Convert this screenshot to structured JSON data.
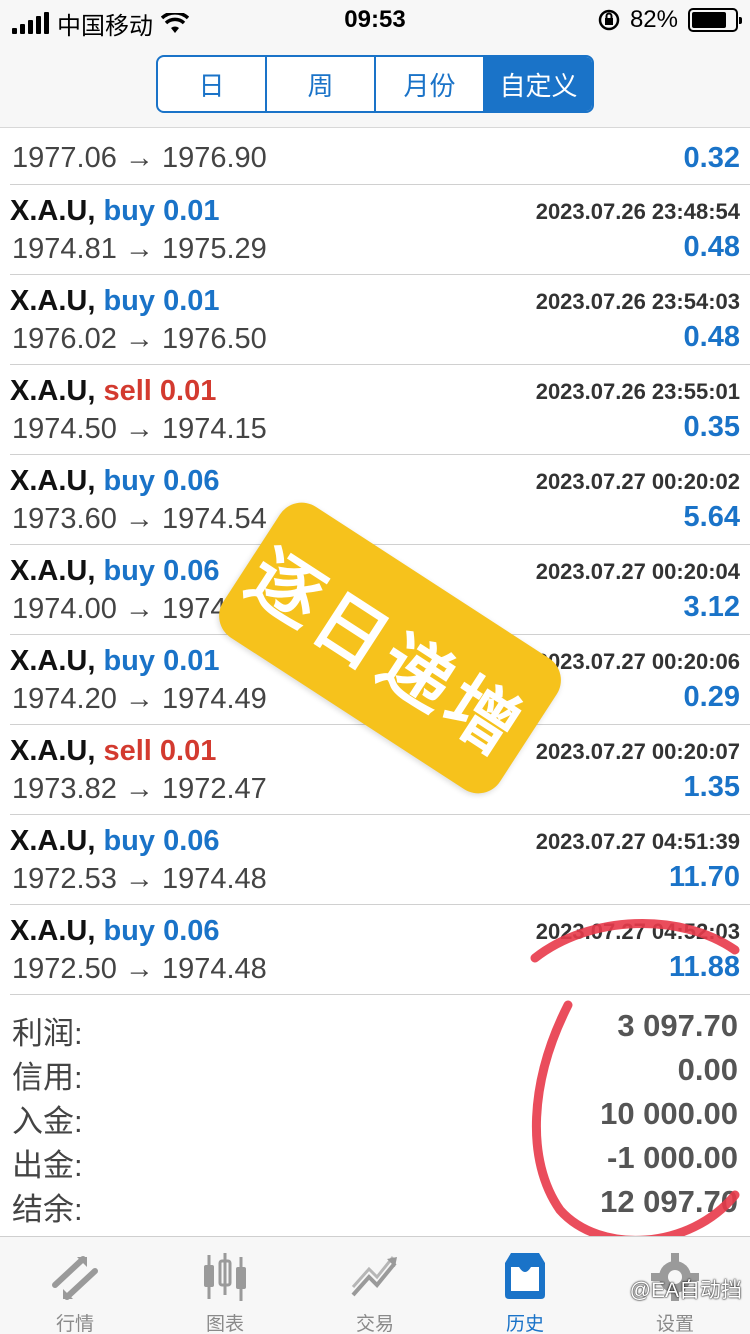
{
  "status_bar": {
    "carrier": "中国移动",
    "time": "09:53",
    "battery": "82%",
    "battery_level": 0.82
  },
  "segments": [
    {
      "label": "日",
      "active": false
    },
    {
      "label": "周",
      "active": false
    },
    {
      "label": "月份",
      "active": false
    },
    {
      "label": "自定义",
      "active": true
    }
  ],
  "deals": [
    {
      "symbol": "",
      "side": "",
      "side_class": "",
      "time": "",
      "prices": "1977.06 → 1976.90",
      "profit": "0.32",
      "partial": true
    },
    {
      "symbol": "X.A.U,",
      "side": "buy 0.01",
      "side_class": "buy",
      "time": "2023.07.26 23:48:54",
      "prices": "1974.81 → 1975.29",
      "profit": "0.48"
    },
    {
      "symbol": "X.A.U,",
      "side": "buy 0.01",
      "side_class": "buy",
      "time": "2023.07.26 23:54:03",
      "prices": "1976.02 → 1976.50",
      "profit": "0.48"
    },
    {
      "symbol": "X.A.U,",
      "side": "sell 0.01",
      "side_class": "sell",
      "time": "2023.07.26 23:55:01",
      "prices": "1974.50 → 1974.15",
      "profit": "0.35"
    },
    {
      "symbol": "X.A.U,",
      "side": "buy 0.06",
      "side_class": "buy",
      "time": "2023.07.27 00:20:02",
      "prices": "1973.60 → 1974.54",
      "profit": "5.64"
    },
    {
      "symbol": "X.A.U,",
      "side": "buy 0.06",
      "side_class": "buy",
      "time": "2023.07.27 00:20:04",
      "prices": "1974.00 → 1974",
      "profit": "3.12"
    },
    {
      "symbol": "X.A.U,",
      "side": "buy 0.01",
      "side_class": "buy",
      "time": "2023.07.27 00:20:06",
      "prices": "1974.20 → 1974.49",
      "profit": "0.29"
    },
    {
      "symbol": "X.A.U,",
      "side": "sell 0.01",
      "side_class": "sell",
      "time": "2023.07.27 00:20:07",
      "prices": "1973.82 → 1972.47",
      "profit": "1.35"
    },
    {
      "symbol": "X.A.U,",
      "side": "buy 0.06",
      "side_class": "buy",
      "time": "2023.07.27 04:51:39",
      "prices": "1972.53 → 1974.48",
      "profit": "11.70"
    },
    {
      "symbol": "X.A.U,",
      "side": "buy 0.06",
      "side_class": "buy",
      "time": "2023.07.27 04:52:03",
      "prices": "1972.50 → 1974.48",
      "profit": "11.88"
    }
  ],
  "summary": [
    {
      "label": "利润:",
      "value": "3 097.70"
    },
    {
      "label": "信用:",
      "value": "0.00"
    },
    {
      "label": "入金:",
      "value": "10 000.00"
    },
    {
      "label": "出金:",
      "value": "-1 000.00"
    },
    {
      "label": "结余:",
      "value": "12 097.70"
    }
  ],
  "tabs": [
    {
      "label": "行情",
      "icon": "quotes-icon",
      "active": false
    },
    {
      "label": "图表",
      "icon": "chart-icon",
      "active": false
    },
    {
      "label": "交易",
      "icon": "trade-icon",
      "active": false
    },
    {
      "label": "历史",
      "icon": "history-icon",
      "active": true
    },
    {
      "label": "设置",
      "icon": "settings-icon",
      "active": false
    }
  ],
  "sticker_text": "逐日递增",
  "watermark": "@EA自动挡",
  "colors": {
    "accent": "#1a73c8",
    "sell": "#d33a2f",
    "sticker": "#f6c21c",
    "circle": "#e83a4a"
  }
}
